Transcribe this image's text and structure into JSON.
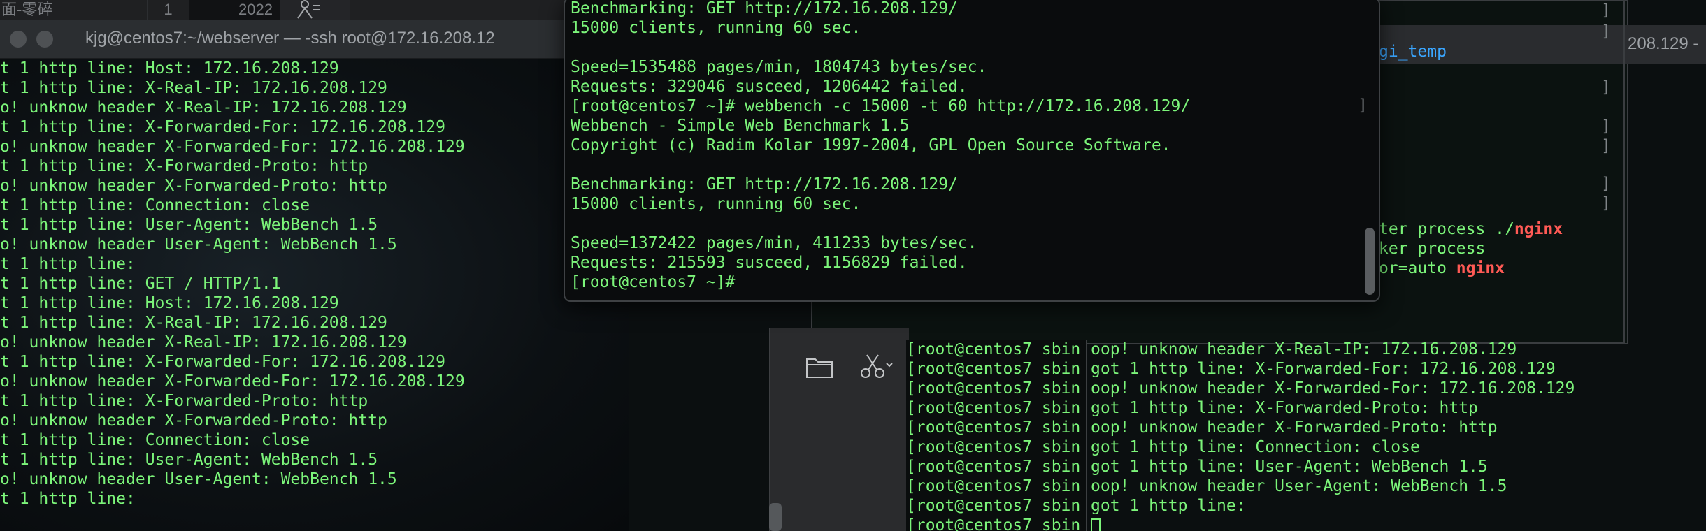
{
  "top_strip": {
    "title": "面-零碎",
    "num": "1",
    "year": "2022"
  },
  "left_window": {
    "title": "kjg@centos7:~/webserver — -ssh root@172.16.208.12",
    "lines": [
      "t 1 http line: Host: 172.16.208.129",
      "t 1 http line: X-Real-IP: 172.16.208.129",
      "o! unknow header X-Real-IP: 172.16.208.129",
      "t 1 http line: X-Forwarded-For: 172.16.208.129",
      "o! unknow header X-Forwarded-For: 172.16.208.129",
      "t 1 http line: X-Forwarded-Proto: http",
      "o! unknow header X-Forwarded-Proto: http",
      "t 1 http line: Connection: close",
      "t 1 http line: User-Agent: WebBench 1.5",
      "o! unknow header User-Agent: WebBench 1.5",
      "t 1 http line:",
      "t 1 http line: GET / HTTP/1.1",
      "t 1 http line: Host: 172.16.208.129",
      "t 1 http line: X-Real-IP: 172.16.208.129",
      "o! unknow header X-Real-IP: 172.16.208.129",
      "t 1 http line: X-Forwarded-For: 172.16.208.129",
      "o! unknow header X-Forwarded-For: 172.16.208.129",
      "t 1 http line: X-Forwarded-Proto: http",
      "o! unknow header X-Forwarded-Proto: http",
      "t 1 http line: Connection: close",
      "t 1 http line: User-Agent: WebBench 1.5",
      "o! unknow header User-Agent: WebBench 1.5",
      "t 1 http line:"
    ]
  },
  "right_window": {
    "title_tail": "208.129 -",
    "gi_temp": "gi_temp",
    "frag1_a": "ter process ./",
    "frag1_b": "nginx",
    "frag2": "ker process",
    "frag3_a": "or=auto ",
    "frag3_b": "nginx"
  },
  "popup": {
    "lines": [
      "Benchmarking: GET http://172.16.208.129/",
      "15000 clients, running 60 sec.",
      "",
      "Speed=1535488 pages/min, 1804743 bytes/sec.",
      "Requests: 329046 susceed, 1206442 failed.",
      "[root@centos7 ~]# webbench -c 15000 -t 60 http://172.16.208.129/",
      "Webbench - Simple Web Benchmark 1.5",
      "Copyright (c) Radim Kolar 1997-2004, GPL Open Source Software.",
      "",
      "Benchmarking: GET http://172.16.208.129/",
      "15000 clients, running 60 sec.",
      "",
      "Speed=1372422 pages/min, 411233 bytes/sec.",
      "Requests: 215593 susceed, 1156829 failed.",
      "[root@centos7 ~]#"
    ]
  },
  "bottom_right": {
    "prompts": [
      "[root@centos7 sbin",
      "[root@centos7 sbin",
      "[root@centos7 sbin",
      "[root@centos7 sbin",
      "[root@centos7 sbin",
      "[root@centos7 sbin",
      "[root@centos7 sbin",
      "[root@centos7 sbin",
      "[root@centos7 sbin",
      "[root@centos7 sbin"
    ],
    "output": [
      "oop! unknow header X-Real-IP: 172.16.208.129",
      "got 1 http line: X-Forwarded-For: 172.16.208.129",
      "oop! unknow header X-Forwarded-For: 172.16.208.129",
      "got 1 http line: X-Forwarded-Proto: http",
      "oop! unknow header X-Forwarded-Proto: http",
      "got 1 http line: Connection: close",
      "got 1 http line: User-Agent: WebBench 1.5",
      "oop! unknow header User-Agent: WebBench 1.5",
      "got 1 http line:"
    ]
  },
  "colors": {
    "terminal_green": "#7cf57a",
    "link_blue": "#3aa6ff",
    "nginx_red": "#ff5a55"
  },
  "icons": [
    "folder-icon",
    "scissors-icon",
    "chevron-down-icon"
  ]
}
